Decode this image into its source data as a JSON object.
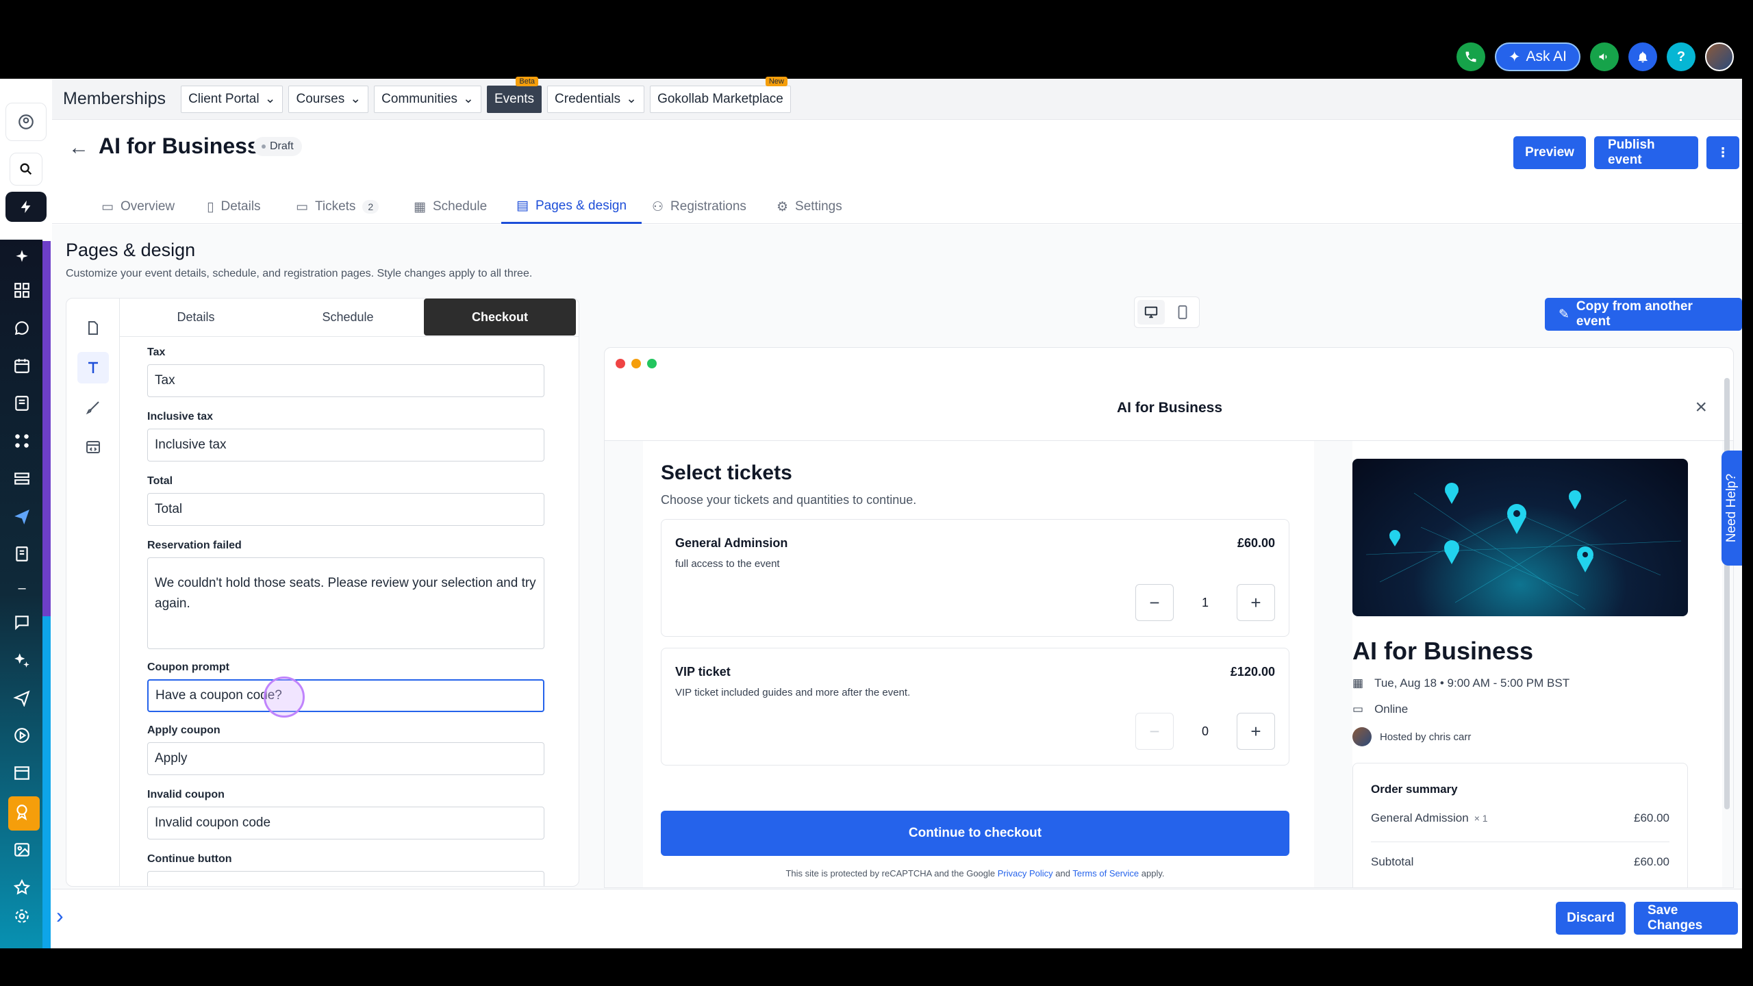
{
  "colors": {
    "accent": "#2563eb",
    "active_tab": "#2d2d2d",
    "badge": "#f59e0b"
  },
  "top_bar": {
    "ask_ai_label": "Ask AI",
    "icons": [
      "phone-icon",
      "sparkle-icon",
      "megaphone-icon",
      "bell-icon",
      "help-icon",
      "avatar"
    ]
  },
  "sidebar": {
    "icons": [
      "account-icon",
      "search-icon",
      "lightning-icon",
      "sparkle-icon",
      "dashboard-icon",
      "chat-icon",
      "calendar-icon",
      "contacts-icon",
      "workflow-icon",
      "opportunities-icon",
      "send-icon",
      "payments-icon",
      "minus-icon",
      "reviews-icon",
      "ai-icon",
      "marketing-icon",
      "reporting-icon",
      "sites-icon",
      "memberships-icon",
      "media-icon",
      "star-icon",
      "settings-icon"
    ]
  },
  "nav": {
    "title": "Memberships",
    "items": [
      {
        "label": "Client Portal",
        "dropdown": true
      },
      {
        "label": "Courses",
        "dropdown": true
      },
      {
        "label": "Communities",
        "dropdown": true
      },
      {
        "label": "Events",
        "badge": "Beta",
        "active": true
      },
      {
        "label": "Credentials",
        "dropdown": true
      },
      {
        "label": "Gokollab Marketplace",
        "badge": "New"
      }
    ]
  },
  "header": {
    "title": "AI for Business",
    "status": "Draft",
    "preview_label": "Preview",
    "publish_label": "Publish event"
  },
  "tabs": [
    {
      "label": "Overview"
    },
    {
      "label": "Details"
    },
    {
      "label": "Tickets",
      "count": "2"
    },
    {
      "label": "Schedule"
    },
    {
      "label": "Pages & design",
      "active": true
    },
    {
      "label": "Registrations"
    },
    {
      "label": "Settings"
    }
  ],
  "section": {
    "title": "Pages & design",
    "subtitle": "Customize your event details, schedule, and registration pages. Style changes apply to all three."
  },
  "editor": {
    "tabs": [
      "Details",
      "Schedule",
      "Checkout"
    ],
    "active_tab": "Checkout",
    "fields": [
      {
        "label": "Tax",
        "value": "Tax"
      },
      {
        "label": "Inclusive tax",
        "value": "Inclusive tax"
      },
      {
        "label": "Total",
        "value": "Total"
      },
      {
        "label": "Reservation failed",
        "value": "We couldn't hold those seats. Please review your selection and try again."
      },
      {
        "label": "Coupon prompt",
        "value": "Have a coupon code?"
      },
      {
        "label": "Apply coupon",
        "value": "Apply"
      },
      {
        "label": "Invalid coupon",
        "value": "Invalid coupon code"
      },
      {
        "label": "Continue button",
        "value": ""
      }
    ]
  },
  "preview": {
    "copy_label": "Copy from another event",
    "window_title": "AI for Business",
    "select_title": "Select tickets",
    "select_sub": "Choose your tickets and quantities to continue.",
    "tickets": [
      {
        "name": "General Adminsion",
        "desc": "full access to the event",
        "price": "£60.00",
        "qty": "1"
      },
      {
        "name": "VIP ticket",
        "desc": "VIP ticket included guides and more after the event.",
        "price": "£120.00",
        "qty": "0"
      }
    ],
    "checkout_label": "Continue to checkout",
    "recaptcha_pre": "This site is protected by reCAPTCHA and the Google ",
    "privacy": "Privacy Policy",
    "and": " and ",
    "terms": "Terms of Service",
    "apply": " apply.",
    "event_title": "AI for Business",
    "date": "Tue, Aug 18 • 9:00 AM - 5:00 PM BST",
    "location": "Online",
    "host": "Hosted by chris carr",
    "order_title": "Order summary",
    "order_item": "General Admission",
    "order_qty": "× 1",
    "order_item_price": "£60.00",
    "subtotal_label": "Subtotal",
    "subtotal_value": "£60.00",
    "need_help": "Need Help?"
  },
  "footer": {
    "discard_label": "Discard",
    "save_label": "Save Changes"
  }
}
